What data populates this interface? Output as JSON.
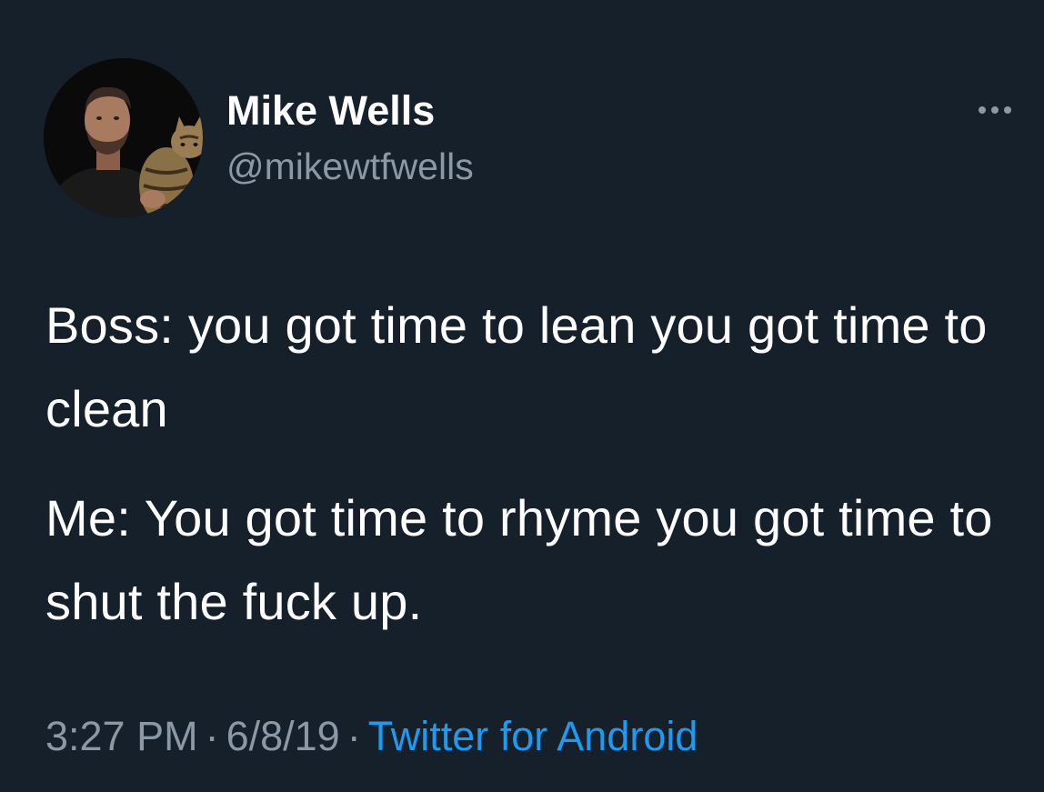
{
  "author": {
    "name": "Mike Wells",
    "handle": "@mikewtfwells"
  },
  "tweet": {
    "paragraphs": [
      "Boss: you got time to lean you got time to clean",
      "Me: You got time to rhyme you got time to shut the fuck up."
    ],
    "time": "3:27 PM",
    "separator": "·",
    "date": "6/8/19",
    "source": "Twitter for Android"
  },
  "icons": {
    "more": "more-options-icon"
  },
  "colors": {
    "background": "#15202b",
    "primary_text": "#ffffff",
    "secondary_text": "#8b98a5",
    "link": "#1d9bf0"
  }
}
